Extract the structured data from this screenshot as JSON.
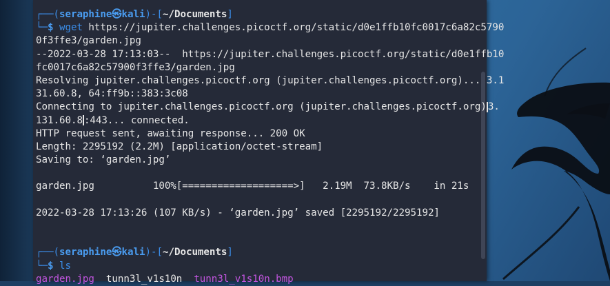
{
  "colors": {
    "terminal_bg": "#252a38",
    "prompt_blue": "#3b8eea",
    "dir_purple": "#c255e0",
    "text": "#e6e6e6"
  },
  "prompt1": {
    "corner_top": "┌──(",
    "user_host": "seraphine㉿kali",
    "sep": ")-[",
    "path": "~/Documents",
    "close": "]",
    "corner_bottom": "└─",
    "dollar": "$ ",
    "command": "wget",
    "args_part1": " https://jupiter.challenges.picoctf.org/static/d0e1ffb10fc0017c6a82c5790",
    "args_part2": "0f3ffe3/garden.jpg"
  },
  "output": {
    "l1": "--2022-03-28 17:13:03--  https://jupiter.challenges.picoctf.org/static/d0e1ffb10",
    "l2": "fc0017c6a82c57900f3ffe3/garden.jpg",
    "l3": "Resolving jupiter.challenges.picoctf.org (jupiter.challenges.picoctf.org)... 3.1",
    "l4": "31.60.8, 64:ff9b::383:3c08",
    "l5a": "Connecting to jupiter.challenges.picoctf.org (jupiter.challenges.picoctf.org)",
    "l5b": "3.",
    "l6a": "131.60.8",
    "l6b": ":443... connected.",
    "l7": "HTTP request sent, awaiting response... 200 OK",
    "l8": "Length: 2295192 (2.2M) [application/octet-stream]",
    "l9": "Saving to: ‘garden.jpg’",
    "l10": "",
    "l11": "garden.jpg          100%[===================>]   2.19M  73.8KB/s    in 21s",
    "l12": "",
    "l13": "2022-03-28 17:13:26 (107 KB/s) - ‘garden.jpg’ saved [2295192/2295192]",
    "l14": "",
    "l15": ""
  },
  "prompt2": {
    "corner_top": "┌──(",
    "user_host": "seraphine㉿kali",
    "sep": ")-[",
    "path": "~/Documents",
    "close": "]",
    "corner_bottom": "└─",
    "dollar": "$ ",
    "command": "ls"
  },
  "ls_output": {
    "file1": "garden.jpg",
    "gap1": "  ",
    "file2": "tunn3l_v1s10n",
    "gap2": "  ",
    "file3": "tunn3l_v1s10n.bmp"
  }
}
